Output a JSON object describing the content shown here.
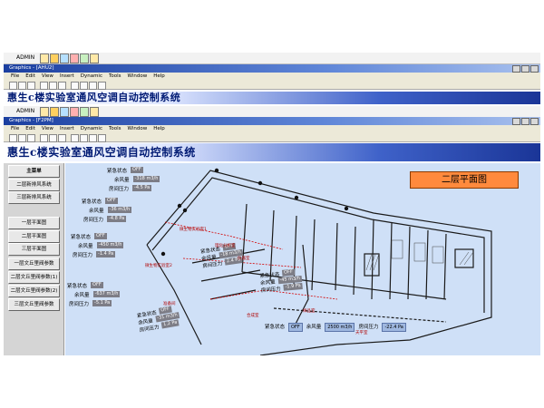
{
  "colors": {
    "window_title_bar": "#1b3fa0",
    "menu_bg": "#ece9d8",
    "banner_text": "#001a73",
    "floorplan_bg": "#cfe0f7",
    "title_box": "#ff8a3d",
    "value_box": "#7d7d86",
    "sidebar_bg": "#d5d5d5"
  },
  "admin_label": "ADMIN",
  "windows": [
    {
      "title": "Graphics - [AHU2]"
    },
    {
      "title": "Graphics - [F2PM]"
    }
  ],
  "menu": [
    "File",
    "Edit",
    "View",
    "Insert",
    "Dynamic",
    "Tools",
    "Window",
    "Help"
  ],
  "banner_title": "惠生c楼实验室通风空调自动控制系统",
  "sidebar": {
    "items": [
      "主菜单",
      "二层新排风系统",
      "三层新排风系统",
      "一层平面图",
      "二层平面图",
      "三层平面图",
      "一层文丘里阀参数",
      "二层文丘里阀参数(1)",
      "二层文丘里阀参数(2)",
      "三层文丘里阀参数"
    ]
  },
  "floor_title": "二层平面图",
  "panels": [
    {
      "labels": [
        "紧急状态",
        "余风量",
        "房间压力"
      ],
      "values": [
        "OFF",
        "-318 m3/h",
        "-4.5 Pa"
      ]
    },
    {
      "labels": [
        "紧急状态",
        "余风量",
        "房间压力"
      ],
      "values": [
        "OFF",
        "-36 m3/h",
        "-4.8 Pa"
      ]
    },
    {
      "labels": [
        "紧急状态",
        "余风量",
        "房间压力"
      ],
      "values": [
        "OFF",
        "-450 m3/h",
        "-1.4 Pa"
      ]
    },
    {
      "labels": [
        "紧急状态",
        "余风量",
        "房间压力"
      ],
      "values": [
        "OFF",
        "-637 m3/h",
        "-5.1 Pa"
      ]
    }
  ],
  "small_panels": [
    {
      "labels": [
        "紧急状态",
        "余风量",
        "房间压力"
      ],
      "values": [
        "OFF",
        "-18 m3/h",
        "2.4 Pa"
      ]
    },
    {
      "labels": [
        "紧急状态",
        "余风量",
        "房间压力"
      ],
      "values": [
        "OFF",
        "-45 m3/h",
        "-1.9 Pa"
      ]
    },
    {
      "labels": [
        "紧急状态",
        "余风量",
        "房间压力"
      ],
      "values": [
        "OFF",
        "-31 m3/h",
        "1.2 Pa"
      ]
    }
  ],
  "room_tags": [
    "微生物实验室1",
    "微生物实验室2",
    "理化分析室",
    "仪器室",
    "准备间",
    "合成室",
    "样品室",
    "天平室"
  ],
  "bottom_strip": [
    {
      "label": "紧急状态",
      "value": "OFF"
    },
    {
      "label": "余风量",
      "value": "2500 m3/h"
    },
    {
      "label": "房间压力",
      "value": "-22.4 Pa"
    }
  ]
}
